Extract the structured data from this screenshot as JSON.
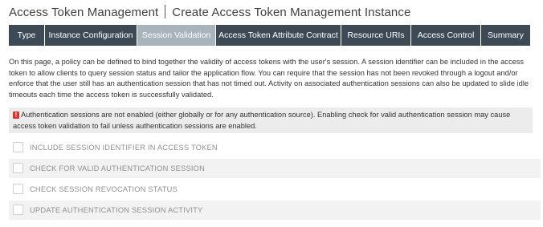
{
  "header": {
    "section": "Access Token Management",
    "title": "Create Access Token Management Instance"
  },
  "tabs": [
    {
      "label": "Type",
      "active": false
    },
    {
      "label": "Instance Configuration",
      "active": false
    },
    {
      "label": "Session Validation",
      "active": true
    },
    {
      "label": "Access Token Attribute Contract",
      "active": false
    },
    {
      "label": "Resource URIs",
      "active": false
    },
    {
      "label": "Access Control",
      "active": false
    },
    {
      "label": "Summary",
      "active": false
    }
  ],
  "intro": "On this page, a policy can be defined to bind together the validity of access tokens with the user's session. A session identifier can be included in the access token to allow clients to query session status and tailor the application flow. You can require that the session has not been revoked through a logout and/or enforce that the user still has an authentication session that has not timed out. Activity on associated authentication sessions can also be updated to slide idle timeouts each time the access token is successfully validated.",
  "warning": {
    "icon": "alert-icon",
    "color": "#d9342b",
    "text": "Authentication sessions are not enabled (either globally or for any authentication source). Enabling check for valid authentication session may cause access token validation to fail unless authentication sessions are enabled."
  },
  "options": [
    {
      "label": "INCLUDE SESSION IDENTIFIER IN ACCESS TOKEN",
      "checked": false,
      "enabled": false
    },
    {
      "label": "CHECK FOR VALID AUTHENTICATION SESSION",
      "checked": false,
      "enabled": false
    },
    {
      "label": "CHECK SESSION REVOCATION STATUS",
      "checked": false,
      "enabled": false
    },
    {
      "label": "UPDATE AUTHENTICATION SESSION ACTIVITY",
      "checked": false,
      "enabled": false
    }
  ],
  "colors": {
    "tab_bg": "#3d4a55",
    "tab_active_bg": "#a9b3bd",
    "warning_bg": "#ececec"
  }
}
